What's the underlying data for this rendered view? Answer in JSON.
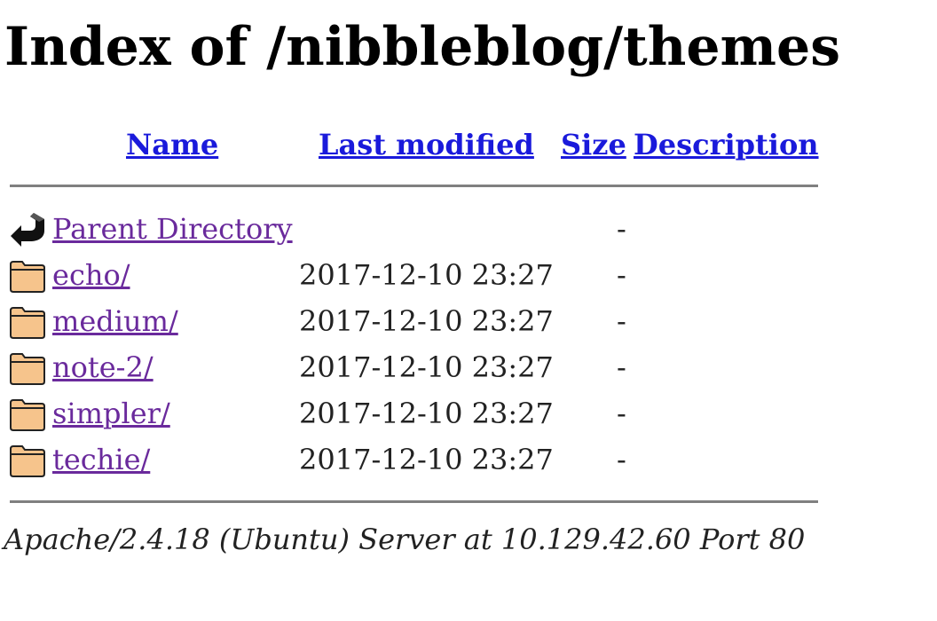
{
  "page_title": "Index of /nibbleblog/themes",
  "columns": {
    "name": "Name",
    "last_modified": "Last modified",
    "size": "Size",
    "description": "Description"
  },
  "parent": {
    "name": "Parent Directory",
    "modified": "",
    "size": "-",
    "icon": "back-arrow-icon"
  },
  "entries": [
    {
      "name": "echo/",
      "modified": "2017-12-10 23:27",
      "size": "-",
      "icon": "folder-icon"
    },
    {
      "name": "medium/",
      "modified": "2017-12-10 23:27",
      "size": "-",
      "icon": "folder-icon"
    },
    {
      "name": "note-2/",
      "modified": "2017-12-10 23:27",
      "size": "-",
      "icon": "folder-icon"
    },
    {
      "name": "simpler/",
      "modified": "2017-12-10 23:27",
      "size": "-",
      "icon": "folder-icon"
    },
    {
      "name": "techie/",
      "modified": "2017-12-10 23:27",
      "size": "-",
      "icon": "folder-icon"
    }
  ],
  "footer": "Apache/2.4.18 (Ubuntu) Server at 10.129.42.60 Port 80",
  "colors": {
    "header_link": "#1a1adb",
    "visited_link": "#6a2a9c",
    "folder_fill": "#f6c48c",
    "rule": "#808080"
  }
}
